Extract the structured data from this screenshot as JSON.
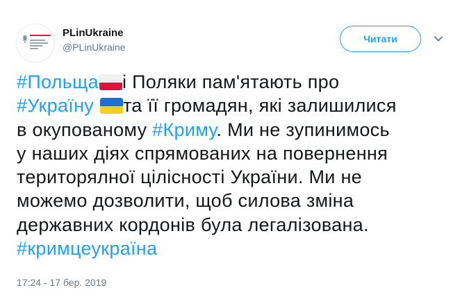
{
  "user": {
    "display_name": "PLinUkraine",
    "handle": "@PLinUkraine"
  },
  "follow_button": {
    "label": "Читати"
  },
  "tweet": {
    "line1": {
      "hashtag": "#Польща",
      "text": "і Поляки пам'ятають про"
    },
    "line2": {
      "hashtag": "#Україну",
      "text": "та її громадян, які залишилися"
    },
    "line3": {
      "text": "в окупованому ",
      "hashtag": "#Криму",
      "text_after": ". Ми не зупинимось"
    },
    "line4": "у наших діях спрямованих на повернення",
    "line5": "територялної цілісності України. Ми не",
    "line6": "можемо дозволити, щоб силова зміна",
    "line7": "державних кордонів була легалізована.",
    "line8": {
      "hashtag": "#кримцеукраїна"
    }
  },
  "timestamp": "17:24 - 17 бер. 2019",
  "colors": {
    "accent": "#1da1f2",
    "text": "#14171a",
    "secondary": "#657786"
  },
  "icons": {
    "avatar": "polish-embassy-logo",
    "caret": "chevron-down-icon",
    "flag_pl": "poland-flag-emoji",
    "flag_ua": "ukraine-flag-emoji"
  }
}
